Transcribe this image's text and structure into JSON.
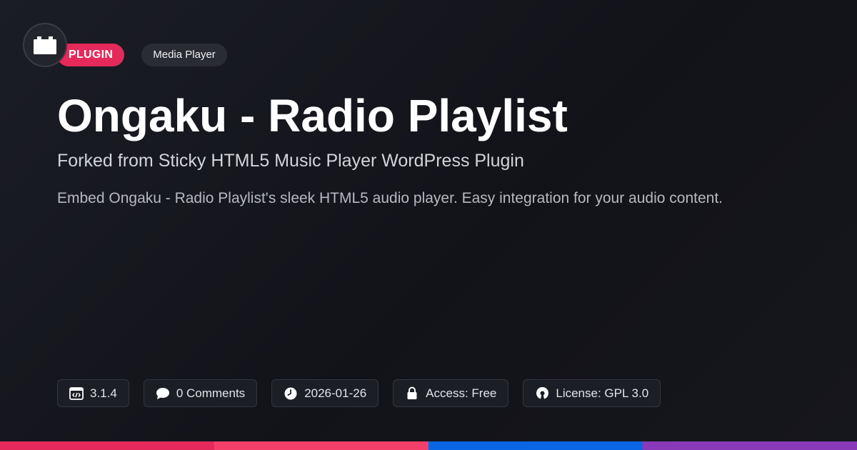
{
  "tags": {
    "type_label": "PLUGIN",
    "category_label": "Media Player"
  },
  "title": "Ongaku - Radio Playlist",
  "subtitle": "Forked from Sticky HTML5 Music Player WordPress Plugin",
  "description": "Embed Ongaku - Radio Playlist's sleek HTML5 audio player. Easy integration for your audio content.",
  "meta": {
    "version": "3.1.4",
    "comments": "0 Comments",
    "date": "2026-01-26",
    "access": "Access: Free",
    "license": "License: GPL 3.0"
  },
  "icons": {
    "logo": "plugin-block-icon",
    "version": "code-window-icon",
    "comments": "speech-bubble-icon",
    "date": "clock-icon",
    "access": "lock-icon",
    "license": "open-source-icon"
  },
  "colors": {
    "accent_pink": "#e5295a",
    "bar": [
      "#e5295a",
      "#f43f6b",
      "#0a66e4",
      "#8a3ab8"
    ]
  }
}
